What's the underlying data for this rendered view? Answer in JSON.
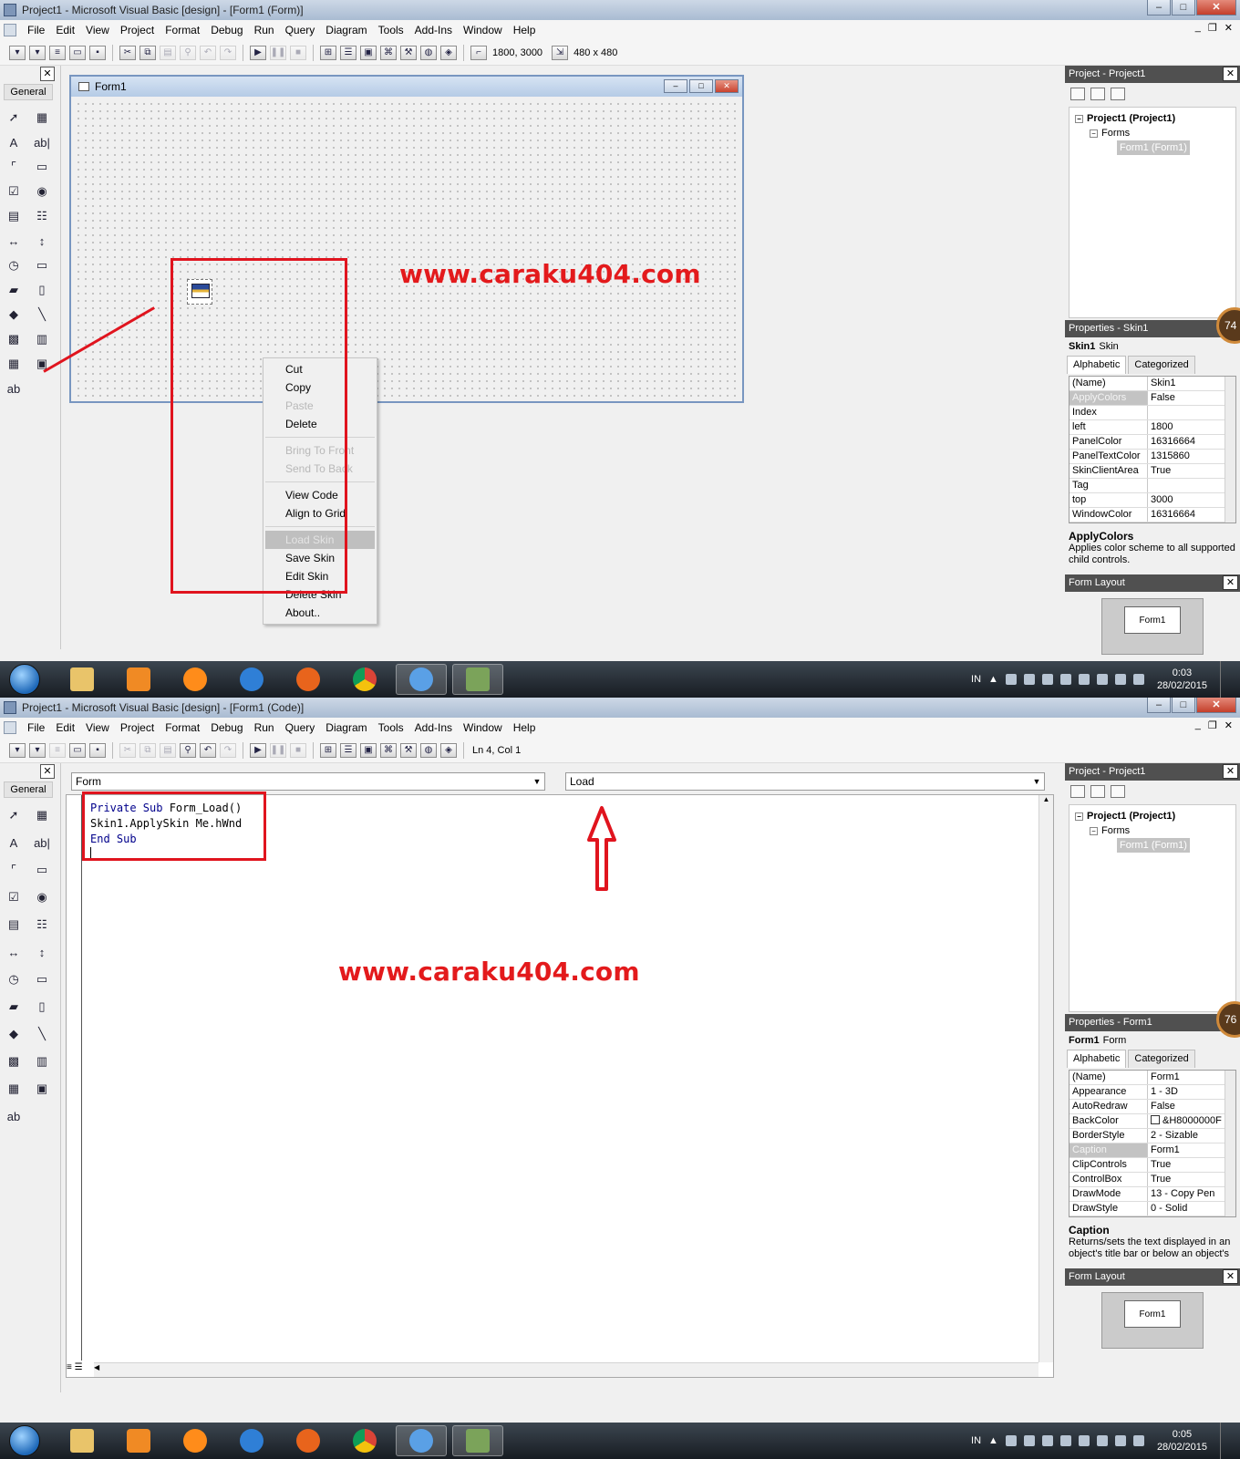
{
  "colors": {
    "annotation_red": "#e0141e",
    "titlebar": "#b5cbe6",
    "pane_header": "#505050",
    "code_keyword": "#00008b"
  },
  "shot1": {
    "title": "Project1 - Microsoft Visual Basic [design] - [Form1 (Form)]",
    "toolbar": {
      "position": "1800, 3000",
      "size": "480 x 480"
    },
    "form_caption": "Form1",
    "context_menu": {
      "cut": "Cut",
      "copy": "Copy",
      "paste": "Paste",
      "delete": "Delete",
      "bring_to_front": "Bring To Front",
      "send_to_back": "Send To Back",
      "view_code": "View Code",
      "align_to_grid": "Align to Grid",
      "load_skin": "Load Skin",
      "save_skin": "Save Skin",
      "edit_skin": "Edit Skin",
      "delete_skin": "Delete Skin",
      "about": "About.."
    },
    "watermark": "www.caraku404.com",
    "properties": {
      "header": "Properties - Skin1",
      "object_name": "Skin1",
      "object_type": "Skin",
      "badge": "74",
      "rows": [
        {
          "name": "(Name)",
          "value": "Skin1"
        },
        {
          "name": "ApplyColors",
          "value": "False"
        },
        {
          "name": "Index",
          "value": ""
        },
        {
          "name": "left",
          "value": "1800"
        },
        {
          "name": "PanelColor",
          "value": "16316664"
        },
        {
          "name": "PanelTextColor",
          "value": "1315860"
        },
        {
          "name": "SkinClientArea",
          "value": "True"
        },
        {
          "name": "Tag",
          "value": ""
        },
        {
          "name": "top",
          "value": "3000"
        },
        {
          "name": "WindowColor",
          "value": "16316664"
        }
      ],
      "desc_title": "ApplyColors",
      "desc_text": "Applies color scheme to all supported child controls."
    },
    "clock": {
      "time": "0:03",
      "date": "28/02/2015"
    }
  },
  "shot2": {
    "title": "Project1 - Microsoft Visual Basic [design] - [Form1 (Code)]",
    "toolbar": {
      "cursor": "Ln 4, Col 1"
    },
    "object_combo": "Form",
    "proc_combo": "Load",
    "code": {
      "line1_kw": "Private Sub",
      "line1_rest": " Form_Load()",
      "line2": "Skin1.ApplySkin Me.hWnd",
      "line3_kw": "End Sub"
    },
    "watermark": "www.caraku404.com",
    "properties": {
      "header": "Properties - Form1",
      "object_name": "Form1",
      "object_type": "Form",
      "badge": "76",
      "rows": [
        {
          "name": "(Name)",
          "value": "Form1"
        },
        {
          "name": "Appearance",
          "value": "1 - 3D"
        },
        {
          "name": "AutoRedraw",
          "value": "False"
        },
        {
          "name": "BackColor",
          "value": "&H8000000F"
        },
        {
          "name": "BorderStyle",
          "value": "2 - Sizable"
        },
        {
          "name": "Caption",
          "value": "Form1"
        },
        {
          "name": "ClipControls",
          "value": "True"
        },
        {
          "name": "ControlBox",
          "value": "True"
        },
        {
          "name": "DrawMode",
          "value": "13 - Copy Pen"
        },
        {
          "name": "DrawStyle",
          "value": "0 - Solid"
        }
      ],
      "desc_title": "Caption",
      "desc_text": "Returns/sets the text displayed in an object's title bar or below an object's"
    },
    "clock": {
      "time": "0:05",
      "date": "28/02/2015"
    }
  },
  "common": {
    "menus": [
      "File",
      "Edit",
      "View",
      "Project",
      "Format",
      "Debug",
      "Run",
      "Query",
      "Diagram",
      "Tools",
      "Add-Ins",
      "Window",
      "Help"
    ],
    "toolbox_title": "General",
    "project_header": "Project - Project1",
    "tree_root": "Project1 (Project1)",
    "tree_forms": "Forms",
    "tree_form1": "Form1 (Form1)",
    "tab_alpha": "Alphabetic",
    "tab_cat": "Categorized",
    "layout_header": "Form Layout",
    "layout_form": "Form1",
    "lang": "IN"
  }
}
